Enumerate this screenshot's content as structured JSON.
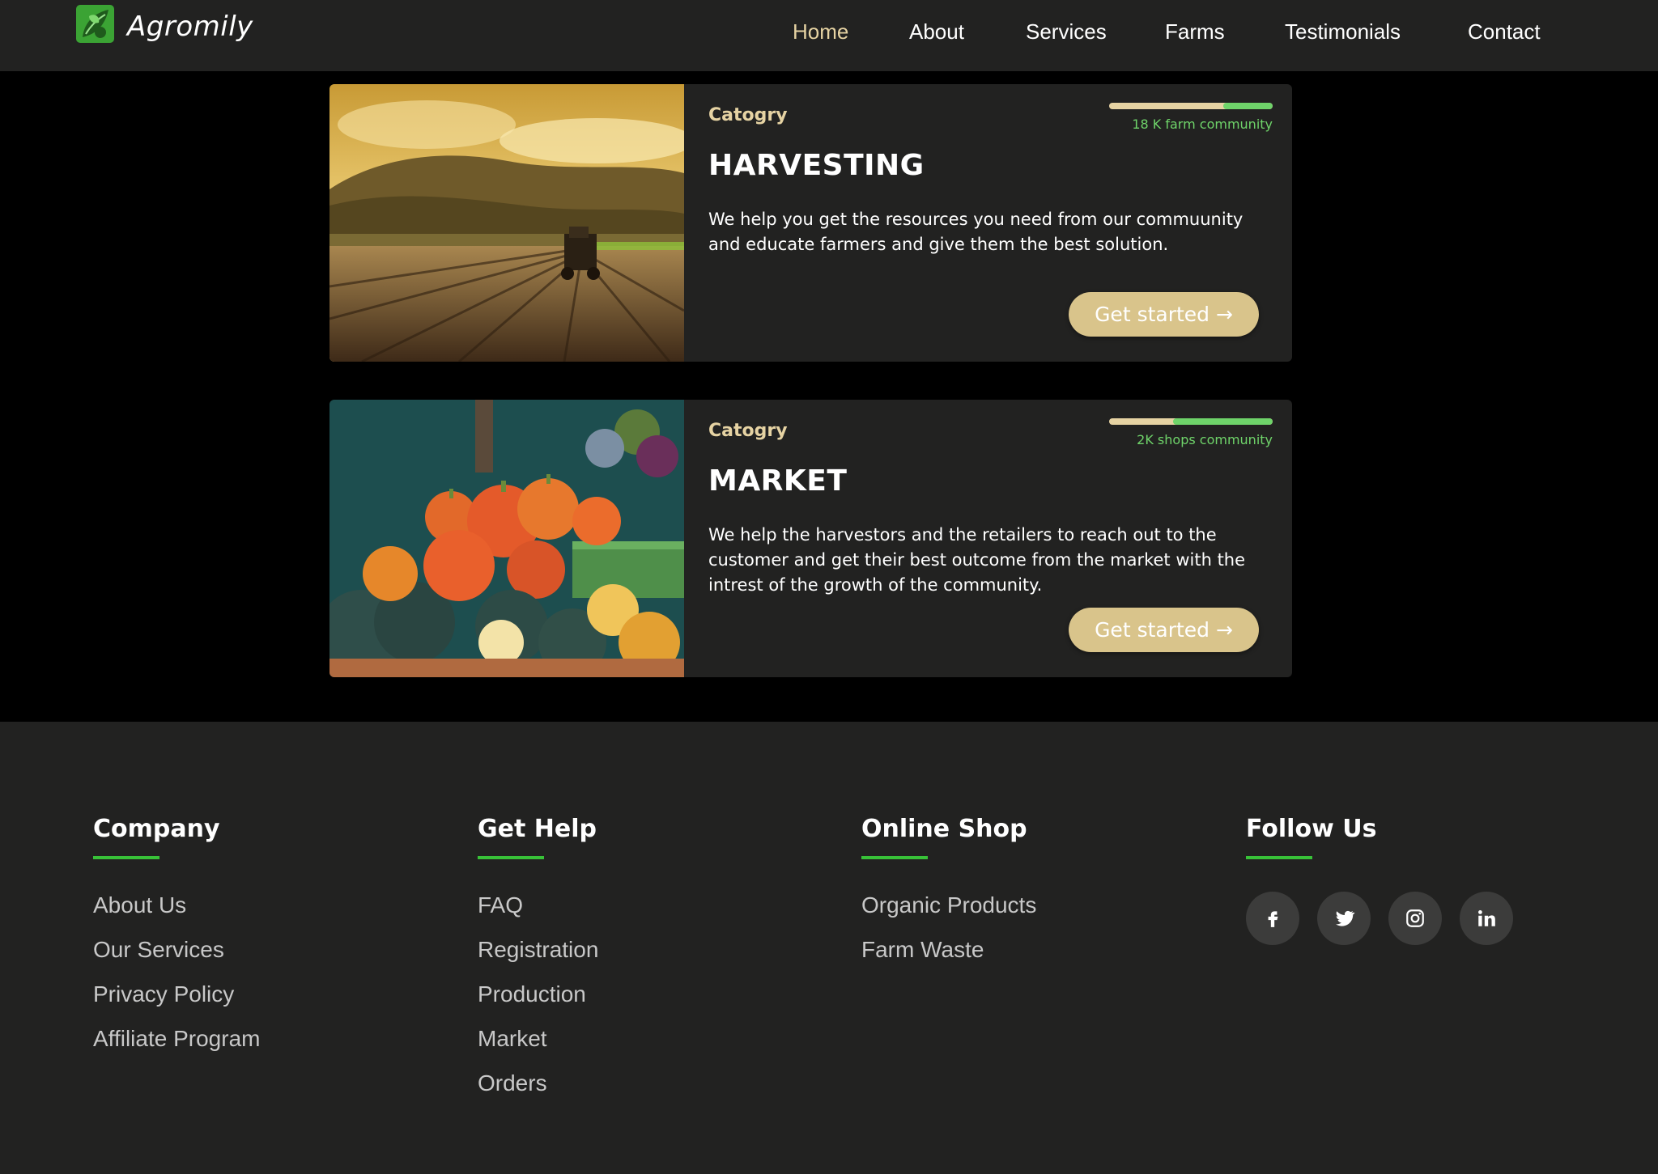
{
  "brand": {
    "name": "Agromily"
  },
  "nav": {
    "items": [
      {
        "label": "Home",
        "active": true
      },
      {
        "label": "About"
      },
      {
        "label": "Services"
      },
      {
        "label": "Farms"
      },
      {
        "label": "Testimonials"
      },
      {
        "label": "Contact"
      }
    ]
  },
  "cards": [
    {
      "category": "Catogry",
      "title": "HARVESTING",
      "description": "We help you get the resources you need from our commuunity and educate farmers and give them the best solution.",
      "progress_label": "18 K farm community",
      "progress_fraction": 0.3,
      "button": "Get started →"
    },
    {
      "category": "Catogry",
      "title": "MARKET",
      "description": "We help the harvestors and the retailers to reach out to the customer and get their best outcome from the market with the intrest of the growth of the community.",
      "progress_label": "2K shops community",
      "progress_fraction": 0.61,
      "button": "Get started →"
    }
  ],
  "footer": {
    "columns": [
      {
        "title": "Company",
        "links": [
          "About Us",
          "Our Services",
          "Privacy Policy",
          "Affiliate Program"
        ]
      },
      {
        "title": "Get Help",
        "links": [
          "FAQ",
          "Registration",
          "Production",
          "Market",
          "Orders"
        ]
      },
      {
        "title": "Online Shop",
        "links": [
          "Organic Products",
          "Farm Waste"
        ]
      },
      {
        "title": "Follow Us",
        "socials": [
          "facebook-icon",
          "twitter-icon",
          "instagram-icon",
          "linkedin-icon"
        ]
      }
    ]
  },
  "colors": {
    "background": "#000000",
    "surface": "#222221",
    "accent_beige": "#e6d3a3",
    "button": "#d9c48b",
    "accent_green": "#6fd46a",
    "underline_green": "#38c238"
  }
}
